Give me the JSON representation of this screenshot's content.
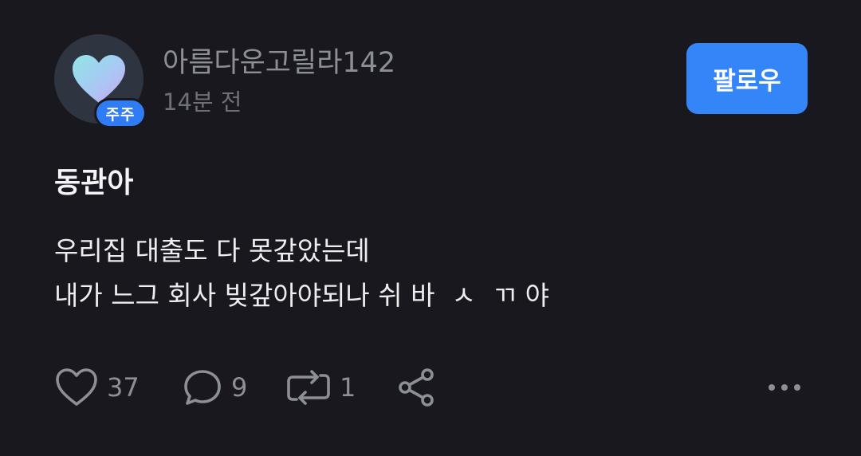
{
  "post": {
    "author": {
      "username": "아름다운고릴라142",
      "badge": "주주",
      "time": "14분 전",
      "avatar_icon": "heart-icon"
    },
    "follow_label": "팔로우",
    "title": "동관아",
    "body_lines": [
      "우리집 대출도 다 못갚았는데",
      "내가 느그 회사 빚갚아야되나 쉬 바  ㅅ  ㄲ 야"
    ],
    "actions": {
      "likes": "37",
      "comments": "9",
      "reposts": "1"
    }
  },
  "colors": {
    "background": "#18181e",
    "accent": "#3485f7",
    "muted_text": "#8d8f96"
  }
}
